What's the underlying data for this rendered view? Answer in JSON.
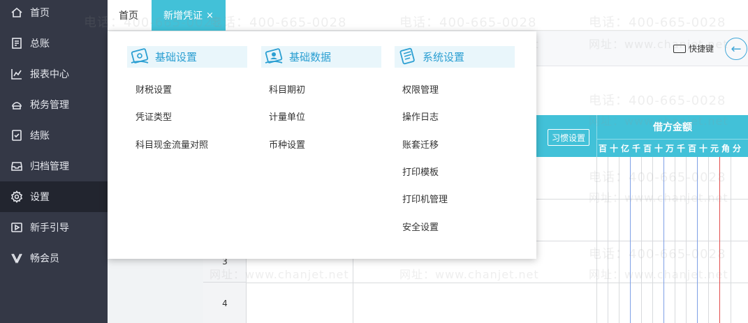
{
  "sidebar": {
    "items": [
      {
        "label": "首页",
        "icon": "home-icon"
      },
      {
        "label": "总账",
        "icon": "ledger-icon"
      },
      {
        "label": "报表中心",
        "icon": "chart-icon"
      },
      {
        "label": "税务管理",
        "icon": "tax-icon"
      },
      {
        "label": "结账",
        "icon": "checkout-icon"
      },
      {
        "label": "归档管理",
        "icon": "archive-icon"
      },
      {
        "label": "设置",
        "icon": "gear-icon",
        "active": true
      },
      {
        "label": "新手引导",
        "icon": "guide-icon"
      },
      {
        "label": "畅会员",
        "icon": "vip-icon"
      }
    ]
  },
  "tabs": {
    "home": "首页",
    "active": "新增凭证",
    "close": "×"
  },
  "toolbar": {
    "shortcut_label": "快捷键",
    "back_icon": "←"
  },
  "voucher": {
    "habit_button": "习惯设置",
    "debit_title": "借方金额",
    "digits": [
      "百",
      "十",
      "亿",
      "千",
      "百",
      "十",
      "万",
      "千",
      "百",
      "十",
      "元",
      "角",
      "分"
    ],
    "rows": [
      "3",
      "4"
    ]
  },
  "menu": {
    "sections": [
      {
        "title": "基础设置",
        "items": [
          "财税设置",
          "凭证类型",
          "科目现金流量对照"
        ]
      },
      {
        "title": "基础数据",
        "items": [
          "科目期初",
          "计量单位",
          "币种设置"
        ]
      },
      {
        "title": "系统设置",
        "items": [
          "权限管理",
          "操作日志",
          "账套迁移",
          "打印模板",
          "打印机管理",
          "安全设置"
        ]
      }
    ]
  },
  "watermark": {
    "phone": "电话：400-665-0028",
    "site": "网址：www.chanjet.net"
  },
  "colors": {
    "sidebar_bg": "#343846",
    "sidebar_active": "#22252f",
    "accent": "#42c1d8",
    "menu_header_text": "#2b9fd2"
  }
}
